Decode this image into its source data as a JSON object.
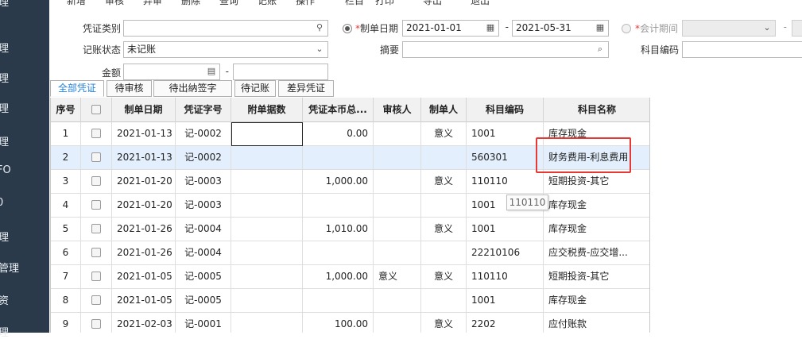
{
  "sidebar": {
    "items": [
      "理",
      "理",
      "理",
      "理",
      "理",
      "FO",
      "0",
      "理",
      "管理",
      "资",
      "理"
    ]
  },
  "topbar": {
    "items": [
      "新增",
      "审核",
      "弃审",
      "删除",
      "查询",
      "记账",
      "操作",
      "栏目",
      "打印",
      "导出",
      "退出"
    ]
  },
  "filter": {
    "voucher_type_label": "凭证类别",
    "voucher_type_value": "",
    "post_status_label": "记账状态",
    "post_status_value": "未记账",
    "amount_label": "金额",
    "amount_from": "",
    "amount_to": "",
    "dash": "-",
    "date_label": "制单日期",
    "date_from": "2021-01-01",
    "date_to": "2021-05-31",
    "summary_label": "摘要",
    "summary_value": "",
    "period_label": "会计期间",
    "period_value": "",
    "account_code_label": "科目编码",
    "account_code_value": "",
    "required_mark": "*"
  },
  "tabs": [
    "全部凭证",
    "待审核",
    "待出纳签字",
    "待记账",
    "差异凭证"
  ],
  "table": {
    "columns": [
      "序号",
      "",
      "制单日期",
      "凭证字号",
      "附单据数",
      "凭证本币总...",
      "审核人",
      "制单人",
      "科目编码",
      "科目名称"
    ],
    "rows": [
      {
        "no": "1",
        "date": "2021-01-13",
        "voucher": "记-0002",
        "attach": "",
        "amount": "0.00",
        "auditor": "",
        "maker": "意义",
        "code": "1001",
        "name": "库存现金"
      },
      {
        "no": "2",
        "date": "2021-01-13",
        "voucher": "记-0002",
        "attach": "",
        "amount": "",
        "auditor": "",
        "maker": "",
        "code": "560301",
        "name": "财务费用-利息费用"
      },
      {
        "no": "3",
        "date": "2021-01-20",
        "voucher": "记-0003",
        "attach": "",
        "amount": "1,000.00",
        "auditor": "",
        "maker": "意义",
        "code": "110110",
        "name": "短期投资-其它"
      },
      {
        "no": "4",
        "date": "2021-01-20",
        "voucher": "记-0003",
        "attach": "",
        "amount": "",
        "auditor": "",
        "maker": "",
        "code": "1001",
        "name": "库存现金"
      },
      {
        "no": "5",
        "date": "2021-01-26",
        "voucher": "记-0004",
        "attach": "",
        "amount": "1,010.00",
        "auditor": "",
        "maker": "意义",
        "code": "1001",
        "name": "库存现金"
      },
      {
        "no": "6",
        "date": "2021-01-26",
        "voucher": "记-0004",
        "attach": "",
        "amount": "",
        "auditor": "",
        "maker": "",
        "code": "22210106",
        "name": "应交税费-应交增..."
      },
      {
        "no": "7",
        "date": "2021-01-05",
        "voucher": "记-0005",
        "attach": "",
        "amount": "1,000.00",
        "auditor": "意义",
        "maker": "意义",
        "code": "110110",
        "name": "短期投资-其它"
      },
      {
        "no": "8",
        "date": "2021-01-05",
        "voucher": "记-0005",
        "attach": "",
        "amount": "",
        "auditor": "",
        "maker": "",
        "code": "1001",
        "name": "库存现金"
      },
      {
        "no": "9",
        "date": "2021-02-03",
        "voucher": "记-0001",
        "attach": "",
        "amount": "100.00",
        "auditor": "",
        "maker": "意义",
        "code": "2202",
        "name": "应付账款"
      }
    ]
  },
  "tooltip": "110110",
  "colors": {
    "sidebar": "#2b3a4a",
    "highlight_box": "#e53935",
    "active_tab": "#1f7fd6",
    "selected_row": "#e3effc"
  }
}
